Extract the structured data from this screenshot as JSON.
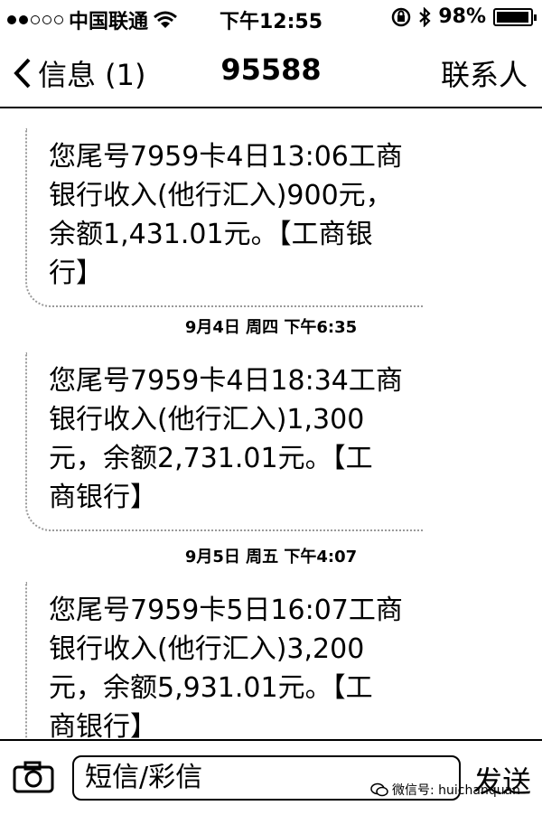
{
  "status_bar": {
    "carrier": "中国联通",
    "time": "下午12:55",
    "battery": "98%",
    "battery_level": 0.98
  },
  "nav": {
    "back_label": "信息 (1)",
    "title": "95588",
    "contact_label": "联系人"
  },
  "messages": [
    {
      "lines": [
        "您尾号7959卡4日13:06工商",
        "银行收入(他行汇入)900元，",
        "余额1,431.01元。【工商银",
        "行】"
      ]
    },
    {
      "timestamp": "9月4日 周四 下午6:35",
      "lines": [
        "您尾号7959卡4日18:34工商",
        "银行收入(他行汇入)1,300",
        "元，余额2,731.01元。【工",
        "商银行】"
      ]
    },
    {
      "timestamp": "9月5日 周五 下午4:07",
      "lines": [
        "您尾号7959卡5日16:07工商",
        "银行收入(他行汇入)3,200",
        "元，余额5,931.01元。【工",
        "商银行】"
      ]
    }
  ],
  "input": {
    "placeholder": "短信/彩信",
    "send_label": "发送"
  },
  "watermark": "微信号: huichanquan",
  "icons": {
    "back": "chevron-left-icon",
    "camera": "camera-icon",
    "wifi": "wifi-icon",
    "bluetooth": "bluetooth-icon",
    "lock": "rotation-lock-icon"
  }
}
